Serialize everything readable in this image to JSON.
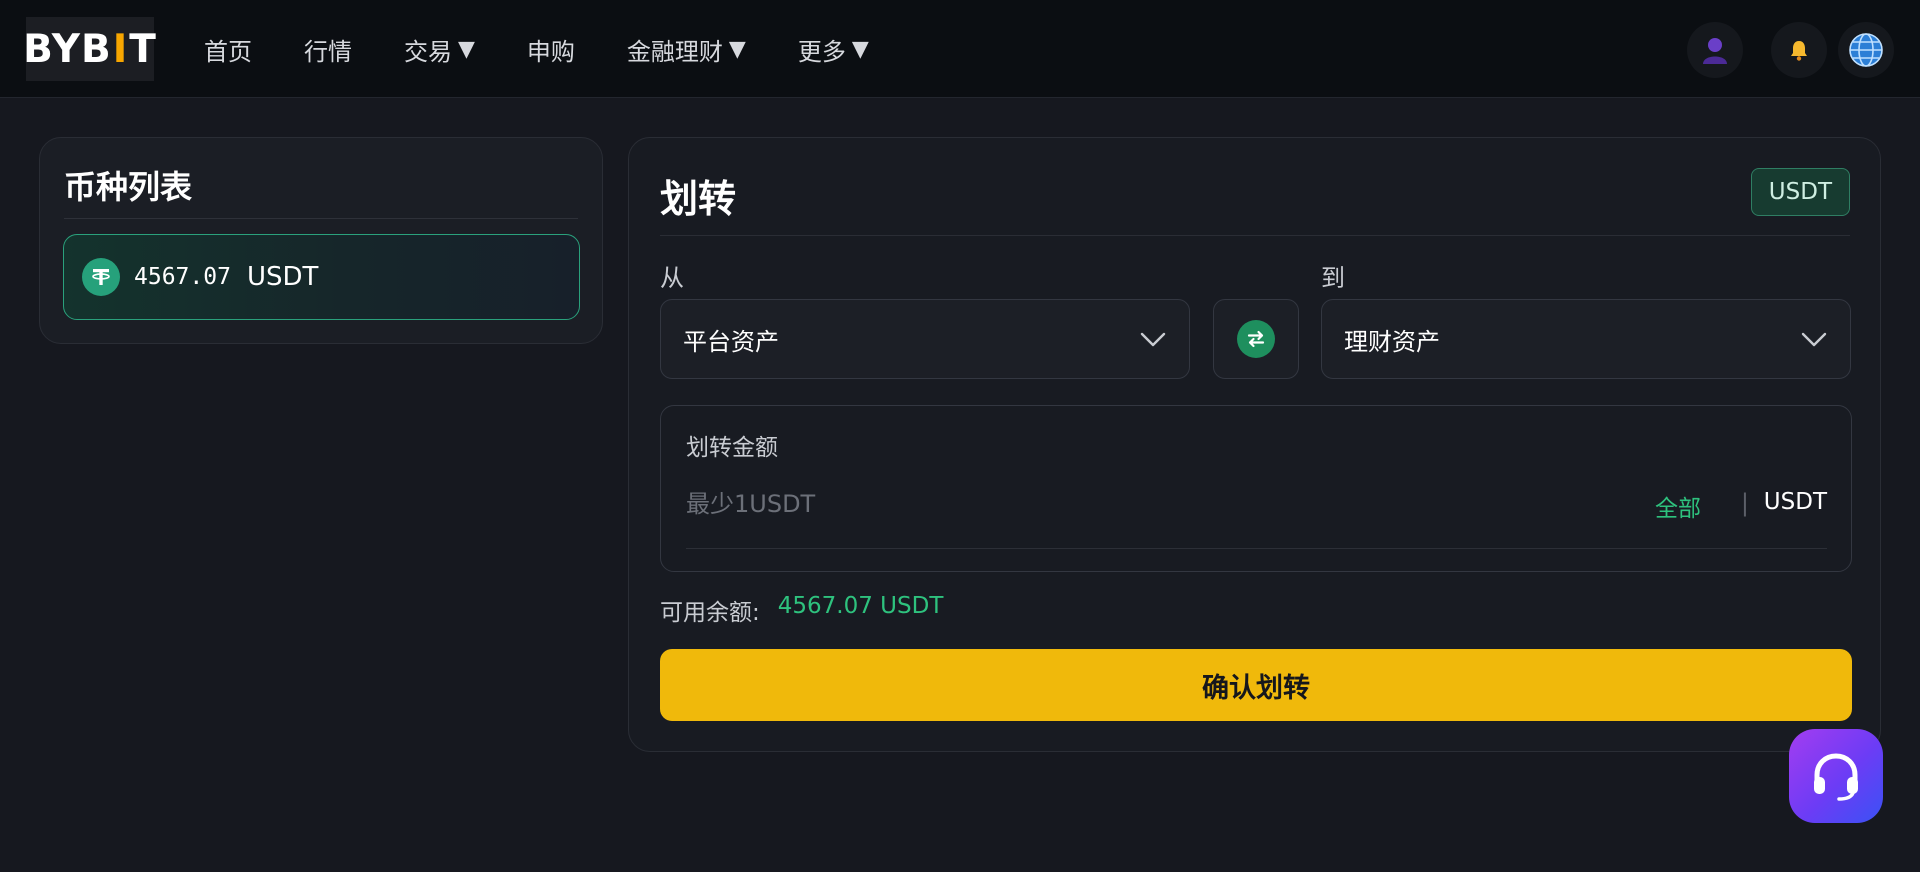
{
  "brand": {
    "logo_pre": "BYB",
    "logo_bar": "I",
    "logo_post": "T"
  },
  "nav": {
    "items": [
      {
        "label": "首页",
        "dropdown": false
      },
      {
        "label": "行情",
        "dropdown": false
      },
      {
        "label": "交易",
        "dropdown": true
      },
      {
        "label": "申购",
        "dropdown": false
      },
      {
        "label": "金融理财",
        "dropdown": true
      },
      {
        "label": "更多",
        "dropdown": true
      }
    ],
    "caret": "▼",
    "icons": [
      "user-avatar-icon",
      "bell-icon",
      "globe-icon"
    ]
  },
  "coin_list": {
    "title": "币种列表",
    "items": [
      {
        "amount": "4567.07",
        "symbol": "USDT",
        "icon": "tether-icon"
      }
    ]
  },
  "transfer": {
    "title": "划转",
    "currency_badge": "USDT",
    "from_label": "从",
    "to_label": "到",
    "from_value": "平台资产",
    "to_value": "理财资产",
    "amount_label": "划转金额",
    "amount_value": "",
    "amount_placeholder": "最少1USDT",
    "all_label": "全部",
    "separator": "|",
    "unit": "USDT",
    "available_label": "可用余额:",
    "available_value": "4567.07 USDT",
    "confirm_label": "确认划转"
  },
  "colors": {
    "accent_yellow": "#f0b90b",
    "accent_green": "#2ec27e",
    "background": "#16181f"
  }
}
